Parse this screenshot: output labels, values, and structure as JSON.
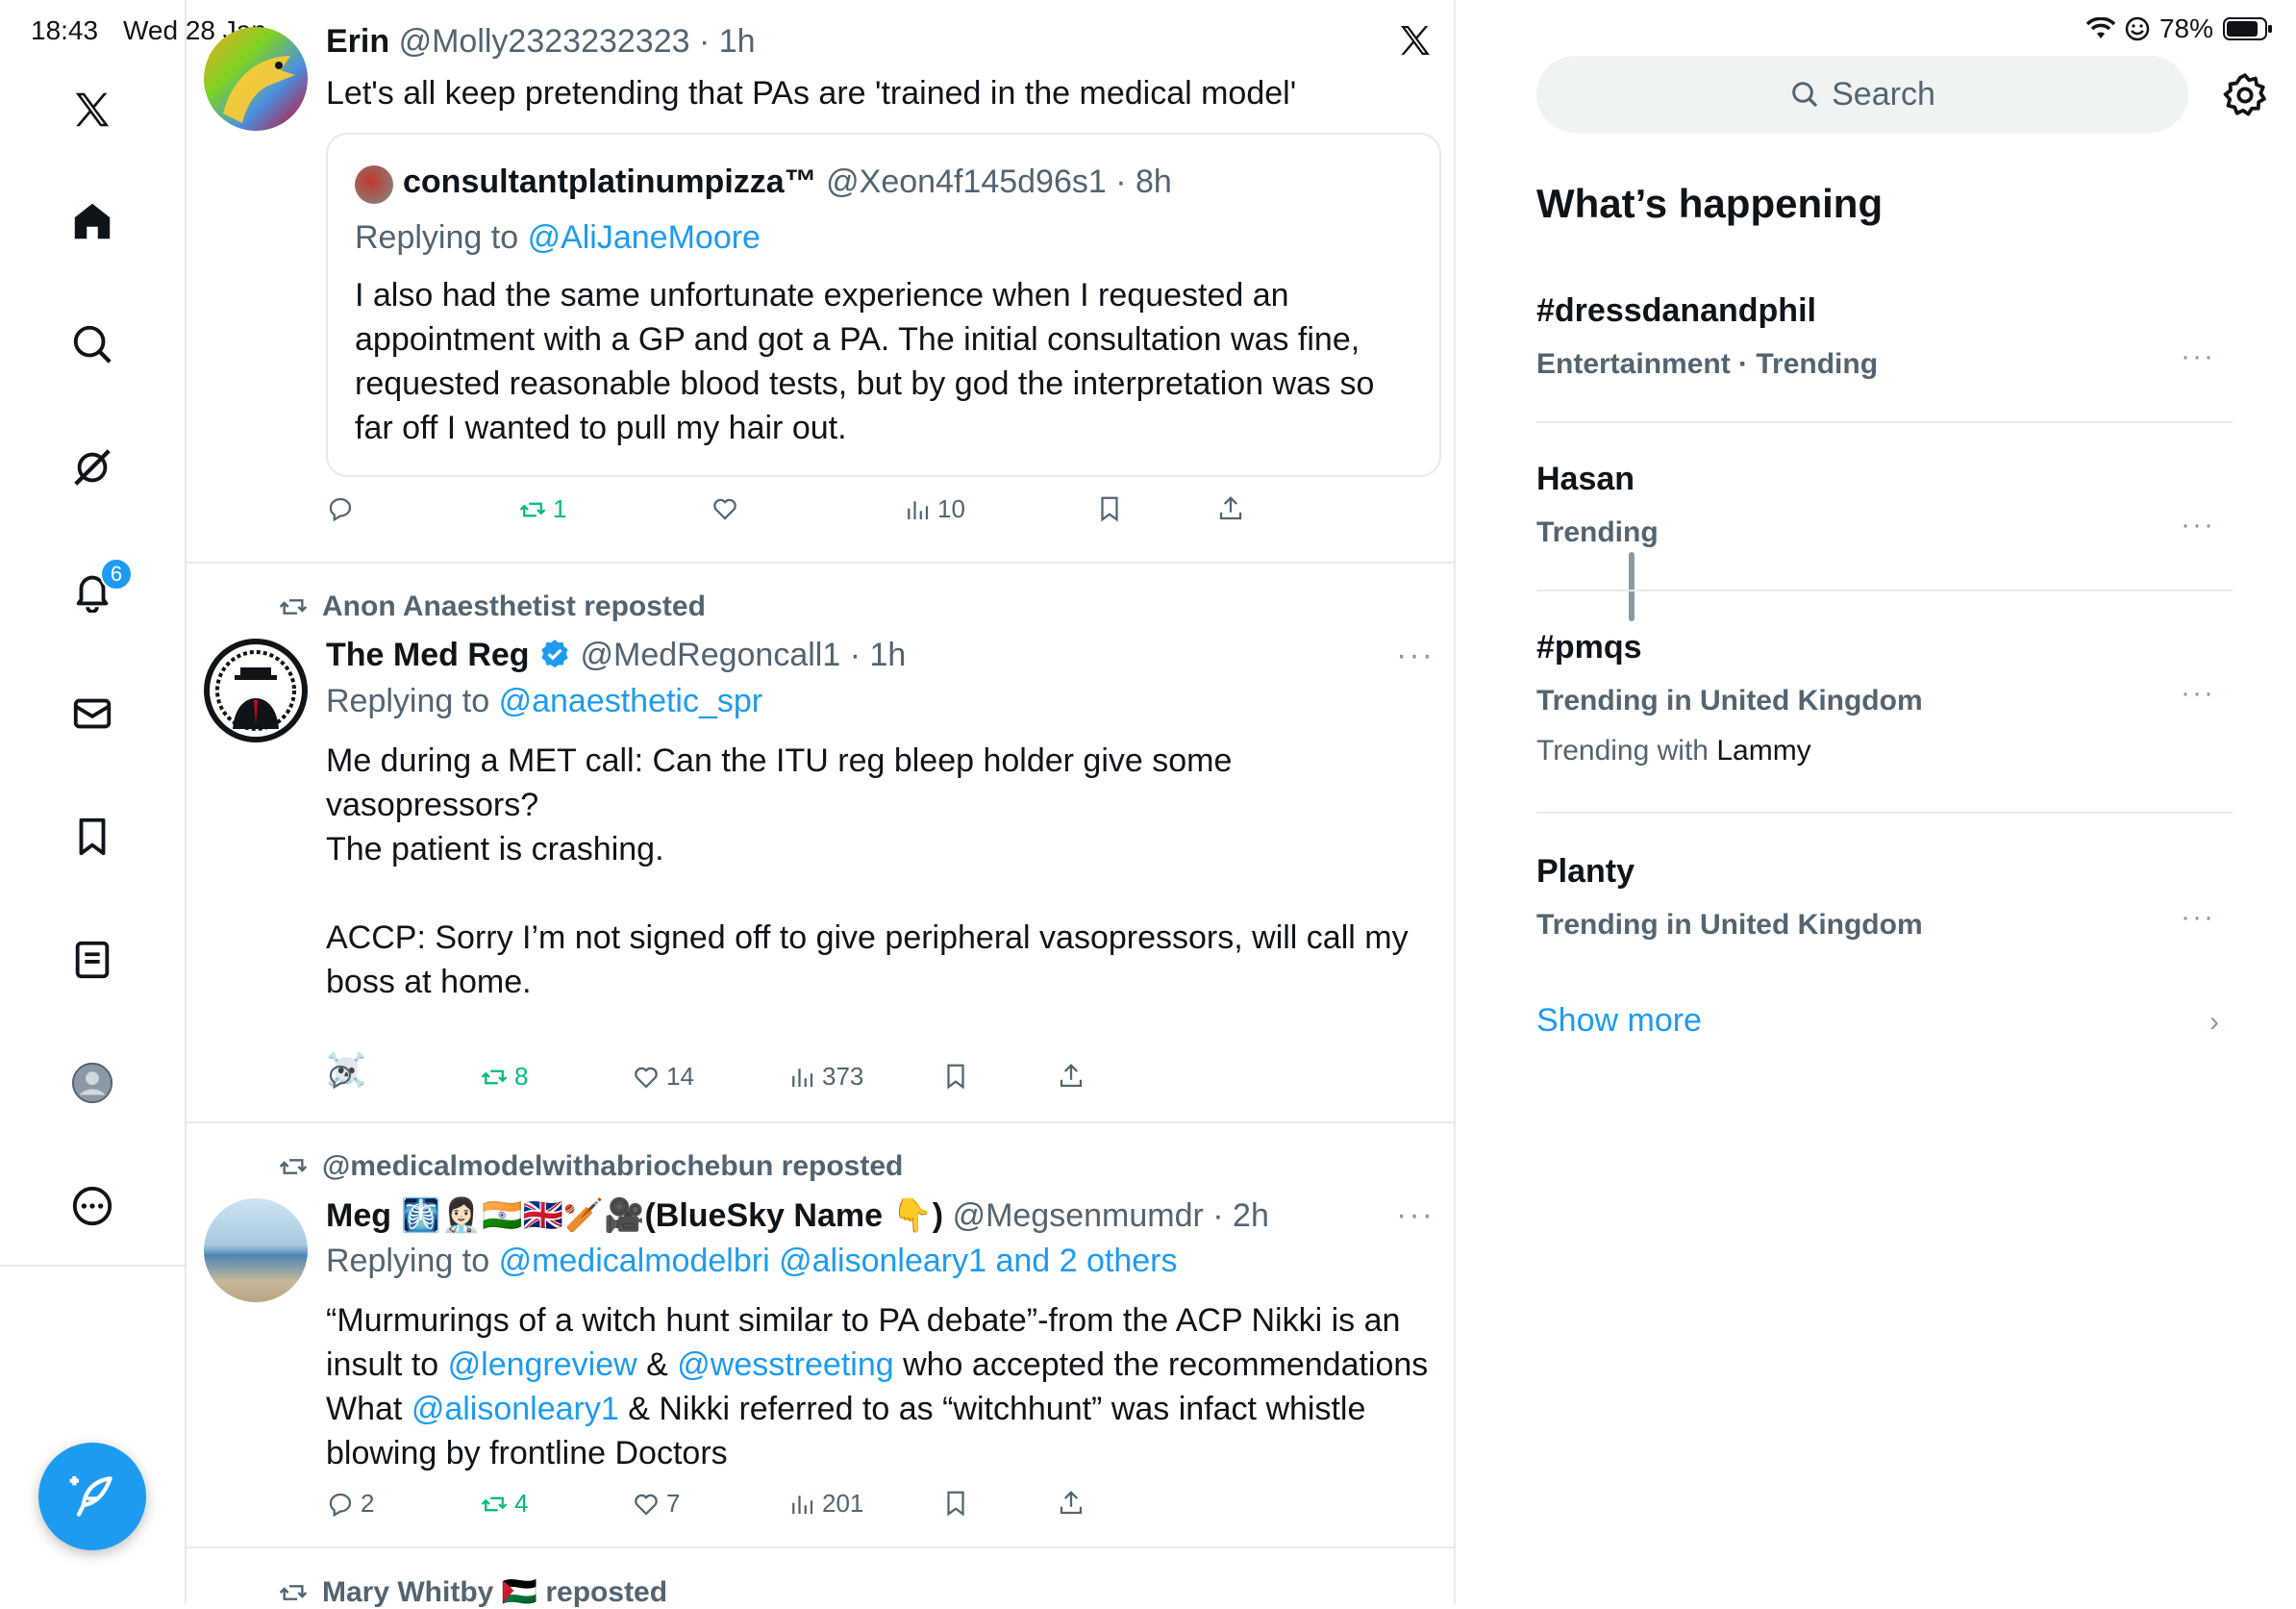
{
  "status_bar": {
    "time": "18:43",
    "date": "Wed 28 Jan",
    "battery": "78%"
  },
  "nav": {
    "items": [
      "x-logo",
      "home-icon",
      "search-icon",
      "grok-icon",
      "bell-icon",
      "mail-icon",
      "bookmark-icon",
      "list-icon",
      "profile-icon",
      "more-icon"
    ],
    "notification_count": "6",
    "accent": "#1d9bf0"
  },
  "tweets": [
    {
      "name": "Erin",
      "handle": "@Molly2323232323",
      "time": "1h",
      "text": "Let's all keep pretending that PAs are 'trained in the medical model'",
      "quote": {
        "name": "consultantplatinumpizza™",
        "handle": "@Xeon4f145d96s1",
        "time": "8h",
        "reply_prefix": "Replying to",
        "reply_to": "@AliJaneMoore",
        "lines": [
          "I also had the same unfortunate experience when I requested an",
          "appointment with a GP and got a PA. The initial consultation was fine,",
          "requested reasonable blood tests, but by god the interpretation was so",
          "far off I wanted to pull my hair out."
        ]
      },
      "actions": {
        "replies": "",
        "reposts": "1",
        "likes": "",
        "views": "10"
      }
    },
    {
      "reposted_by": "Anon Anaesthetist reposted",
      "name": "The Med Reg",
      "handle": "@MedRegoncall1",
      "time": "1h",
      "reply_prefix": "Replying to",
      "reply_to": "@anaesthetic_spr",
      "para1_line1": "Me during a MET call: Can the ITU reg bleep holder give some vasopressors?",
      "para1_line2": "The patient is crashing.",
      "para2_line1": "ACCP: Sorry I’m not signed off to give peripheral vasopressors, will call my",
      "para2_line2": "boss at home.",
      "emoji": "☠️",
      "actions": {
        "replies": "",
        "reposts": "8",
        "likes": "14",
        "views": "373"
      }
    },
    {
      "reposted_by": "@medicalmodelwithabriochebun reposted",
      "name": "Meg 🩻👩🏻‍⚕️🇮🇳🇬🇧🏏🎥(BlueSky Name 👇)",
      "handle": "@Megsenmumdr",
      "time": "2h",
      "reply_prefix": "Replying to",
      "reply_to": "@medicalmodelbri @alisonleary1 and 2 others",
      "line1": "“Murmurings of a witch hunt similar to PA debate”-from the ACP Nikki is an",
      "line2_a": "insult to ",
      "line2_link1": "@lengreview",
      "line2_b": " & ",
      "line2_link2": "@wesstreeting",
      "line2_c": " who accepted the recommendations",
      "line3_a": "What ",
      "line3_link": "@alisonleary1",
      "line3_b": " & Nikki referred to as “witchhunt” was infact whistle",
      "line4": "blowing by frontline Doctors",
      "actions": {
        "replies": "2",
        "reposts": "4",
        "likes": "7",
        "views": "201"
      }
    },
    {
      "reposted_by": "Mary Whitby 🇵🇸 reposted"
    }
  ],
  "search": {
    "placeholder": "Search"
  },
  "trends": {
    "title": "What’s happening",
    "items": [
      {
        "name": "#dressdanandphil",
        "meta": "Entertainment · Trending"
      },
      {
        "name": "Hasan",
        "meta": "Trending"
      },
      {
        "name": "#pmqs",
        "meta": "Trending in United Kingdom",
        "with_prefix": "Trending with",
        "with_name": "Lammy"
      },
      {
        "name": "Planty",
        "meta": "Trending in United Kingdom"
      }
    ],
    "show_more": "Show more"
  }
}
